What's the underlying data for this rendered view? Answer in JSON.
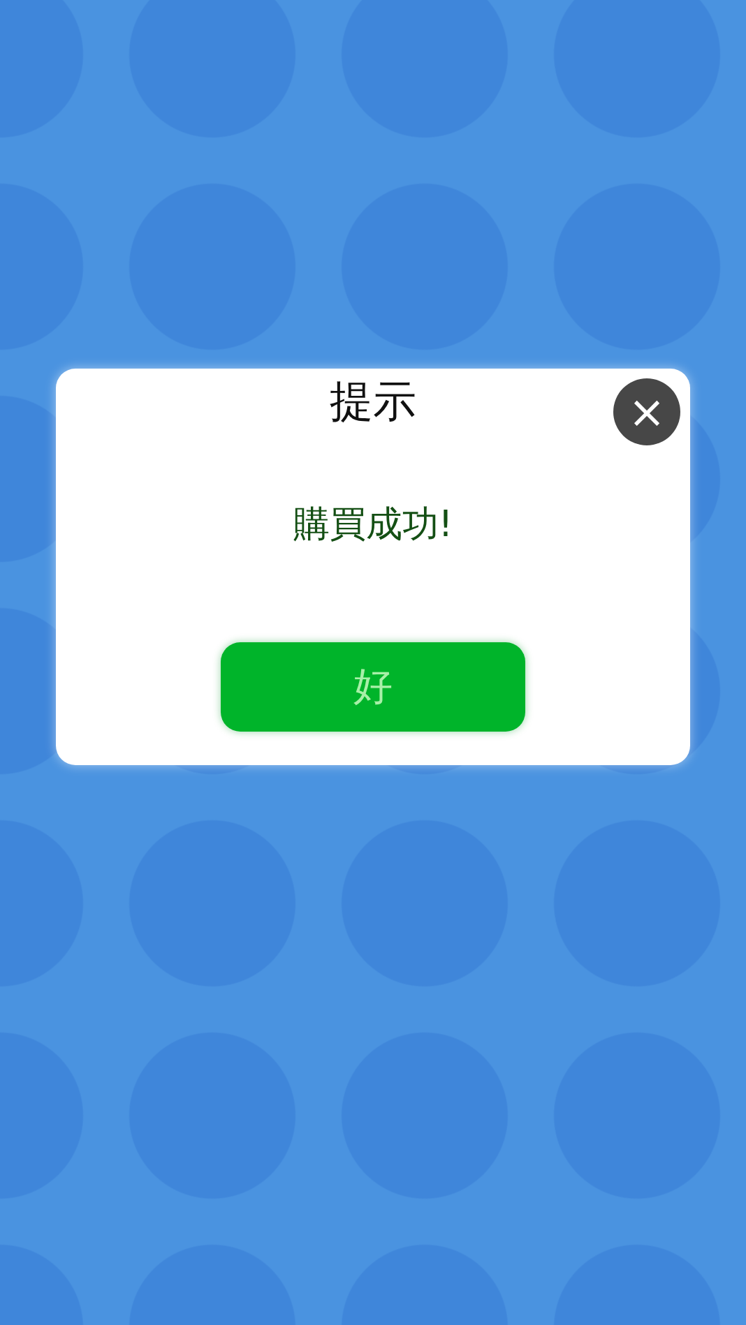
{
  "dialog": {
    "title": "提示",
    "message": "購買成功!",
    "close_label": "×",
    "button": "好"
  }
}
